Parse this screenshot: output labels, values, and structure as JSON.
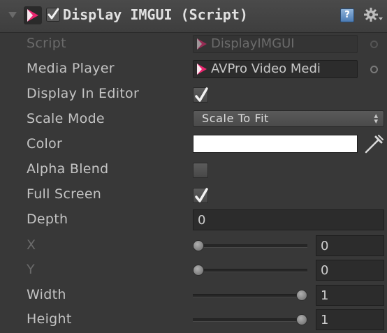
{
  "component": {
    "title": "Display IMGUI (Script)",
    "enabled": true
  },
  "icons": {
    "header": [
      "foldout-arrow-icon",
      "avpro-logo-icon",
      "enable-checkbox-icon",
      "help-icon",
      "gear-icon"
    ],
    "accent_color": "#e8266f",
    "help_glyph": "?"
  },
  "fields": {
    "script": {
      "label": "Script",
      "value": "DisplayIMGUI"
    },
    "media_player": {
      "label": "Media Player",
      "value": "AVPro Video Medi"
    },
    "display_in_editor": {
      "label": "Display In Editor",
      "checked": true
    },
    "scale_mode": {
      "label": "Scale Mode",
      "value": "Scale To Fit",
      "arrows": "▴\n▾"
    },
    "color": {
      "label": "Color",
      "value_hex": "#ffffff"
    },
    "alpha_blend": {
      "label": "Alpha Blend",
      "checked": false
    },
    "full_screen": {
      "label": "Full Screen",
      "checked": true
    },
    "depth": {
      "label": "Depth",
      "value": "0"
    },
    "x": {
      "label": "X",
      "value": "0",
      "slider_fraction": 0.0
    },
    "y": {
      "label": "Y",
      "value": "0",
      "slider_fraction": 0.0
    },
    "width": {
      "label": "Width",
      "value": "1",
      "slider_fraction": 1.0
    },
    "height": {
      "label": "Height",
      "value": "1",
      "slider_fraction": 1.0
    }
  }
}
